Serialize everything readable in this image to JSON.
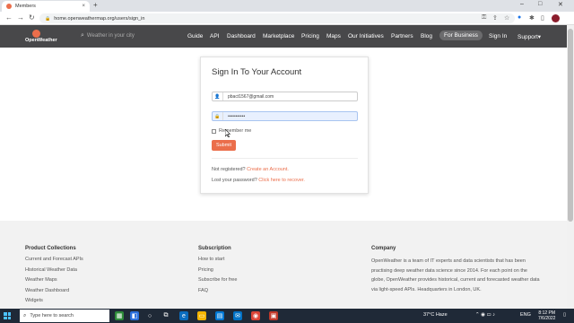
{
  "browser": {
    "tab_title": "Members",
    "tab_close": "×",
    "new_tab": "+",
    "minimize": "–",
    "maximize": "□",
    "close": "✕",
    "url": "home.openweathermap.org/users/sign_in",
    "back": "←",
    "forward": "→",
    "reload": "↻"
  },
  "site": {
    "logo_text": "OpenWeather",
    "search_placeholder": "Weather in your city",
    "nav": [
      "Guide",
      "API",
      "Dashboard",
      "Marketplace",
      "Pricing",
      "Maps",
      "Our Initiatives",
      "Partners",
      "Blog",
      "For Business",
      "Sign In",
      "Support▾"
    ]
  },
  "signin": {
    "title": "Sign In To Your Account",
    "email_value": "pbact1567@gmail.com",
    "password_value": "•••••••••••",
    "remember_label": "Remember me",
    "submit_label": "Submit",
    "not_registered": "Not registered?",
    "create_link": "Create an Account.",
    "lost_password": "Lost your password?",
    "recover_link": "Click here to recover."
  },
  "footer": {
    "product_title": "Product Collections",
    "product_links": [
      "Current and Forecast APIs",
      "Historical Weather Data",
      "Weather Maps",
      "Weather Dashboard",
      "Widgets"
    ],
    "subscription_title": "Subscription",
    "subscription_links": [
      "How to start",
      "Pricing",
      "Subscribe for free",
      "FAQ"
    ],
    "company_title": "Company",
    "company_text": "OpenWeather is a team of IT experts and data scientists that has been practising deep weather data science since 2014. For each point on the globe, OpenWeather provides historical, current and forecasted weather data via light-speed APIs. Headquarters in London, UK."
  },
  "taskbar": {
    "search_placeholder": "Type here to search",
    "weather": "37°C Haze",
    "lang": "ENG",
    "time": "8:12 PM",
    "date": "7/6/2022"
  },
  "colors": {
    "accent": "#eb6e4b",
    "header_bg": "#48484a",
    "taskbar_bg": "#1f2937"
  }
}
